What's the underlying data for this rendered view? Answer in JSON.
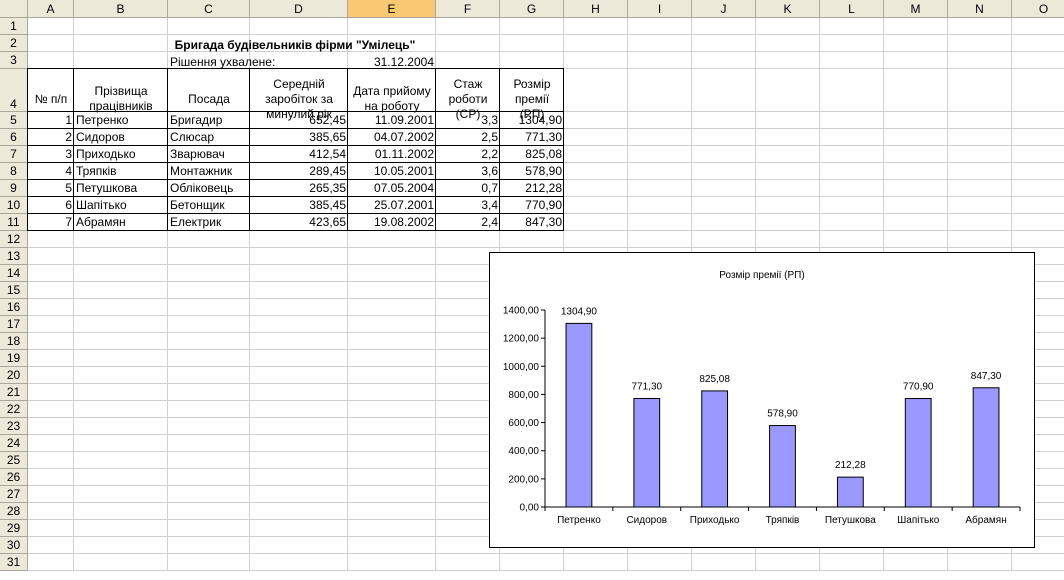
{
  "columns": [
    "A",
    "B",
    "C",
    "D",
    "E",
    "F",
    "G",
    "H",
    "I",
    "J",
    "K",
    "L",
    "M",
    "N",
    "O"
  ],
  "rows": [
    "1",
    "2",
    "3",
    "4",
    "5",
    "6",
    "7",
    "8",
    "9",
    "10",
    "11",
    "12",
    "13",
    "14",
    "15",
    "16",
    "17",
    "18",
    "19",
    "20",
    "21",
    "22",
    "23",
    "24",
    "25",
    "26",
    "27",
    "28",
    "29",
    "30",
    "31"
  ],
  "selected_column": "E",
  "sheet": {
    "title": "Бригада будівельників фірми \"Умілець\"",
    "decision_label": "Рішення ухвалене:",
    "decision_date": "31.12.2004",
    "headers": {
      "num": "№ п/п",
      "surname": "Прізвища працівників",
      "position": "Посада",
      "salary": "Середній заробіток за минулий рік",
      "hire_date": "Дата прийому на роботу",
      "experience": "Стаж роботи (СР)",
      "bonus": "Розмір премії (РП)"
    },
    "rows": [
      {
        "num": "1",
        "surname": "Петренко",
        "position": "Бригадир",
        "salary": "652,45",
        "hire_date": "11.09.2001",
        "experience": "3,3",
        "bonus": "1304,90"
      },
      {
        "num": "2",
        "surname": "Сидоров",
        "position": "Слюсар",
        "salary": "385,65",
        "hire_date": "04.07.2002",
        "experience": "2,5",
        "bonus": "771,30"
      },
      {
        "num": "3",
        "surname": "Приходько",
        "position": "Зварювач",
        "salary": "412,54",
        "hire_date": "01.11.2002",
        "experience": "2,2",
        "bonus": "825,08"
      },
      {
        "num": "4",
        "surname": "Тряпків",
        "position": "Монтажник",
        "salary": "289,45",
        "hire_date": "10.05.2001",
        "experience": "3,6",
        "bonus": "578,90"
      },
      {
        "num": "5",
        "surname": "Петушкова",
        "position": "Обліковець",
        "salary": "265,35",
        "hire_date": "07.05.2004",
        "experience": "0,7",
        "bonus": "212,28"
      },
      {
        "num": "6",
        "surname": "Шапітько",
        "position": "Бетонщик",
        "salary": "385,45",
        "hire_date": "25.07.2001",
        "experience": "3,4",
        "bonus": "770,90"
      },
      {
        "num": "7",
        "surname": "Абрамян",
        "position": "Електрик",
        "salary": "423,65",
        "hire_date": "19.08.2002",
        "experience": "2,4",
        "bonus": "847,30"
      }
    ]
  },
  "chart_data": {
    "type": "bar",
    "title": "Розмір премії (РП)",
    "categories": [
      "Петренко",
      "Сидоров",
      "Приходько",
      "Тряпків",
      "Петушкова",
      "Шапітько",
      "Абрамян"
    ],
    "values": [
      1304.9,
      771.3,
      825.08,
      578.9,
      212.28,
      770.9,
      847.3
    ],
    "value_labels": [
      "1304,90",
      "771,30",
      "825,08",
      "578,90",
      "212,28",
      "770,90",
      "847,30"
    ],
    "yticks": [
      "0,00",
      "200,00",
      "400,00",
      "600,00",
      "800,00",
      "1000,00",
      "1200,00",
      "1400,00"
    ],
    "ylim": [
      0,
      1400
    ],
    "bar_color": "#9999ff",
    "xlabel": "",
    "ylabel": "",
    "legend": "none",
    "grid": false
  }
}
